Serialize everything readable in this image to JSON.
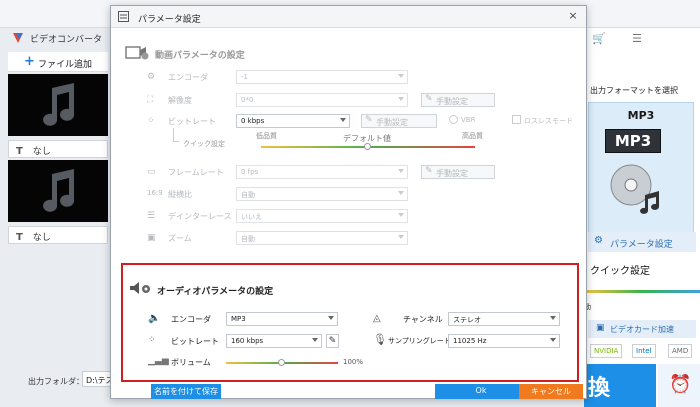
{
  "app": {
    "title": "ビデオコンバータ",
    "add_file": "ファイル追加",
    "files": [
      {
        "rename_icon": "T",
        "name": "なし"
      },
      {
        "rename_icon": "T",
        "name": "なし"
      }
    ],
    "output_folder_label": "出力フォルダ：",
    "output_folder_value": "D:\\テスト"
  },
  "right_panel": {
    "select_format": "出力フォーマットを選択",
    "format_label": "MP3",
    "format_badge": "MP3",
    "param_button": "パラメータ設定",
    "quick_settings": "クイック設定",
    "slider_label": "動",
    "gpu_title": "ビデオカード加速",
    "gpu_chips": [
      "NVIDIA",
      "Intel",
      "AMD"
    ],
    "convert_button": "換",
    "top_controls": [
      "🛒",
      "☰"
    ]
  },
  "dialog": {
    "title": "パラメータ設定",
    "close": "×",
    "video": {
      "section_title": "動画パラメータの設定",
      "encoder_label": "エンコーダ",
      "encoder_value": "-1",
      "resolution_label": "解像度",
      "resolution_value": "0*0",
      "manual_button": "手動設定",
      "bitrate_label": "ビットレート",
      "bitrate_value": "0 kbps",
      "vbr_label": "VBR",
      "lossless_label": "ロスレスモード",
      "quick_label": "クイック設定",
      "quality_low": "低品質",
      "quality_default": "デフォルト値",
      "quality_high": "高品質",
      "framerate_label": "フレームレート",
      "framerate_value": "0 fps",
      "aspect_label": "縦横比",
      "aspect_value": "自動",
      "deinterlace_label": "デインターレース",
      "deinterlace_value": "いいえ",
      "zoom_label": "ズーム",
      "zoom_value": "自動"
    },
    "audio": {
      "section_title": "オーディオパラメータの設定",
      "encoder_label": "エンコーダ",
      "encoder_value": "MP3",
      "channel_label": "チャンネル",
      "channel_value": "ステレオ",
      "bitrate_label": "ビットレート",
      "bitrate_value": "160 kbps",
      "samplerate_label": "サンプリングレート",
      "samplerate_value": "11025 Hz",
      "volume_label": "ボリューム",
      "volume_value": "100%",
      "volume_level": 0.5
    },
    "footer": {
      "save_as": "名前を付けて保存",
      "ok": "Ok",
      "cancel": "キャンセル"
    }
  },
  "colors": {
    "accent_blue": "#1d8fe6",
    "cancel_orange": "#f07a1d",
    "highlight_red": "#d11f1f"
  }
}
